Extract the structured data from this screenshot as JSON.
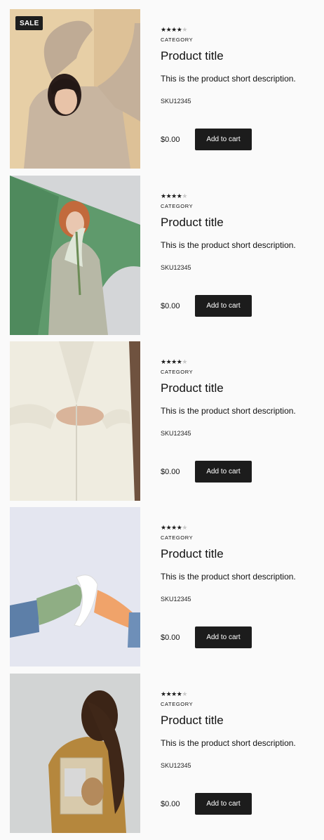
{
  "products": [
    {
      "badge": "SALE",
      "rating": 4,
      "category": "CATEGORY",
      "title": "Product title",
      "description": "This is the product short description.",
      "sku": "SKU12345",
      "price": "$0.00",
      "cta": "Add to cart",
      "image": "woman-beige-sweater-arms-raised"
    },
    {
      "badge": "",
      "rating": 4,
      "category": "CATEGORY",
      "title": "Product title",
      "description": "This is the product short description.",
      "sku": "SKU12345",
      "price": "$0.00",
      "cta": "Add to cart",
      "image": "woman-sage-blazer-green-backdrop"
    },
    {
      "badge": "",
      "rating": 4,
      "category": "CATEGORY",
      "title": "Product title",
      "description": "This is the product short description.",
      "sku": "SKU12345",
      "price": "$0.00",
      "cta": "Add to cart",
      "image": "cream-blazer-closeup"
    },
    {
      "badge": "",
      "rating": 4,
      "category": "CATEGORY",
      "title": "Product title",
      "description": "This is the product short description.",
      "sku": "SKU12345",
      "price": "$0.00",
      "cta": "Add to cart",
      "image": "feet-in-socks-and-heels"
    },
    {
      "badge": "",
      "rating": 4,
      "category": "CATEGORY",
      "title": "Product title",
      "description": "This is the product short description.",
      "sku": "SKU12345",
      "price": "$0.00",
      "cta": "Add to cart",
      "image": "woman-clear-tote-bag"
    }
  ],
  "colors": {
    "background": "#fafafa",
    "button": "#1c1c1c",
    "star_on": "#1a1a1a",
    "star_off": "#c8c8c8"
  }
}
